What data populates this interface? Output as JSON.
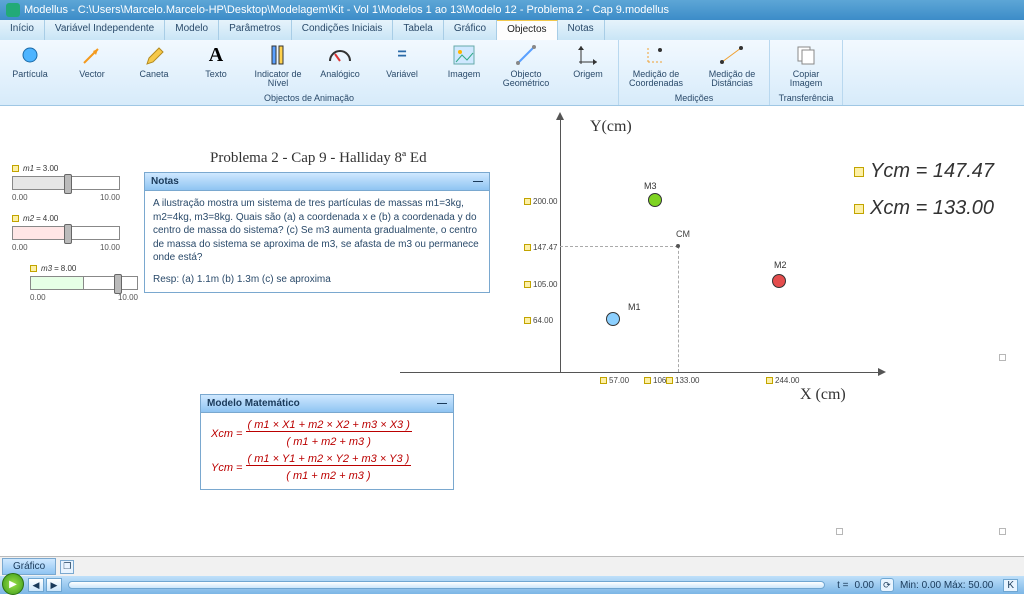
{
  "window": {
    "title": "Modellus - C:\\Users\\Marcelo.Marcelo-HP\\Desktop\\Modelagem\\Kit - Vol 1\\Modelos 1 ao 13\\Modelo 12 - Problema 2 - Cap 9.modellus"
  },
  "menu": {
    "items": [
      "Início",
      "Variável Independente",
      "Modelo",
      "Parâmetros",
      "Condições Iniciais",
      "Tabela",
      "Gráfico",
      "Objectos",
      "Notas"
    ],
    "active": 7
  },
  "ribbon": {
    "groups": [
      {
        "label": "Objectos de Animação",
        "items": [
          "Partícula",
          "Vector",
          "Caneta",
          "Texto",
          "Indicator de Nível",
          "Analógico",
          "Variável",
          "Imagem",
          "Objecto Geométrico",
          "Origem"
        ]
      },
      {
        "label": "Medições",
        "items": [
          "Medição de Coordenadas",
          "Medição de Distâncias"
        ]
      },
      {
        "label": "Transferência",
        "items": [
          "Copiar Imagem"
        ]
      }
    ]
  },
  "problem_title": "Problema 2 - Cap 9 - Halliday 8ª Ed",
  "sliders": [
    {
      "name": "m1",
      "value": "3.00",
      "min": "0.00",
      "max": "10.00",
      "color": "#6a6aff"
    },
    {
      "name": "m2",
      "value": "4.00",
      "min": "0.00",
      "max": "10.00",
      "color": "#ff6a6a"
    },
    {
      "name": "m3",
      "value": "8.00",
      "min": "0.00",
      "max": "10.00",
      "color": "#6aff6a"
    }
  ],
  "notes": {
    "title": "Notas",
    "body": "A ilustração mostra um sistema de tres partículas de massas m1=3kg, m2=4kg, m3=8kg. Quais são (a) a coordenada x e (b) a coordenada y do centro de massa do sistema? (c) Se m3 aumenta gradualmente, o centro de massa do sistema se aproxima de m3, se afasta de m3 ou permanece onde está?",
    "answer": "Resp: (a) 1.1m (b) 1.3m (c) se aproxima"
  },
  "model": {
    "title": "Modelo Matemático",
    "eq1": {
      "lhs": "Xcm",
      "num": "( m1 × X1 + m2 × X2 + m3 × X3 )",
      "den": "( m1 + m2 + m3 )"
    },
    "eq2": {
      "lhs": "Ycm",
      "num": "( m1 × Y1 + m2 × Y2 + m3 × Y3 )",
      "den": "( m1 + m2 + m3 )"
    }
  },
  "axes": {
    "x": "X (cm)",
    "y": "Y(cm)"
  },
  "ticks_y": [
    "200.00",
    "147.47",
    "105.00",
    "64.00"
  ],
  "ticks_x": [
    "57.00",
    "106",
    "133.00",
    "244.00"
  ],
  "particles": {
    "m1": {
      "label": "M1",
      "color": "#7ec3f6"
    },
    "m2": {
      "label": "M2",
      "color": "#e44d4d"
    },
    "m3": {
      "label": "M3",
      "color": "#7ed321"
    },
    "cm": {
      "label": "CM"
    }
  },
  "outputs": {
    "ycm_label": "Ycm",
    "ycm_val": "147.47",
    "xcm_label": "Xcm",
    "xcm_val": "133.00"
  },
  "bottom_tab": "Gráfico",
  "playbar": {
    "t_label": "t  =",
    "t_val": "0.00",
    "range": "Min: 0.00 Máx: 50.00"
  },
  "chart_data": {
    "type": "scatter",
    "title": "Problema 2 - Cap 9 - Halliday 8ª Ed",
    "xlabel": "X (cm)",
    "ylabel": "Y(cm)",
    "xlim": [
      0,
      260
    ],
    "ylim": [
      0,
      210
    ],
    "series": [
      {
        "name": "M1",
        "x": [
          57
        ],
        "y": [
          64
        ],
        "color": "#7ec3f6"
      },
      {
        "name": "M2",
        "x": [
          244
        ],
        "y": [
          105
        ],
        "color": "#e44d4d"
      },
      {
        "name": "M3",
        "x": [
          106
        ],
        "y": [
          200
        ],
        "color": "#7ed321"
      },
      {
        "name": "CM",
        "x": [
          133
        ],
        "y": [
          147.47
        ],
        "color": "#555555"
      }
    ]
  }
}
